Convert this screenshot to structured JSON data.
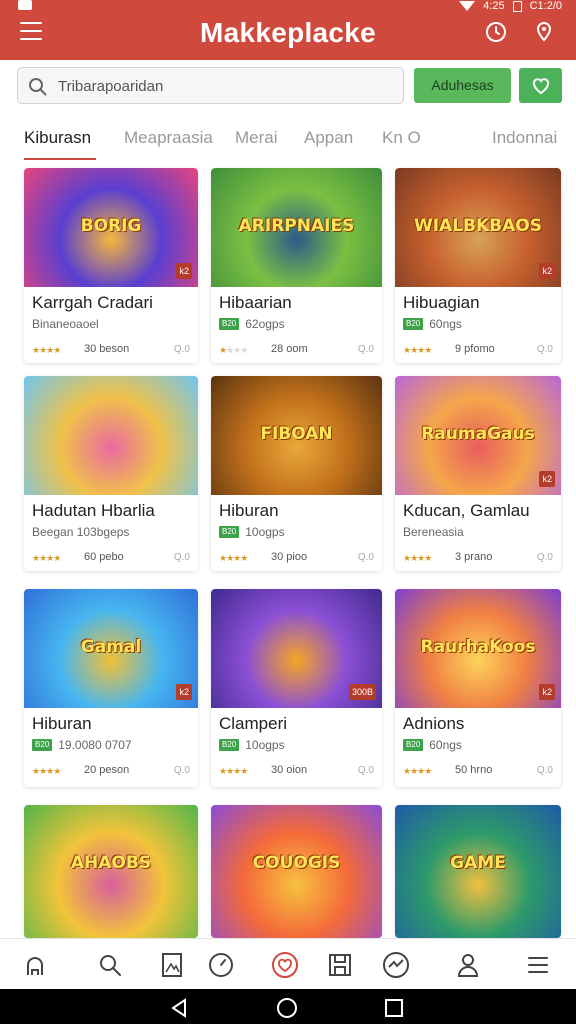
{
  "header": {
    "title": "Makkeplacke",
    "status_time": "4:25",
    "status_extra": "C1:2/0",
    "brand_color": "#cf4a3d"
  },
  "search": {
    "placeholder": "Tribarapoaridan",
    "button_label": "Aduhesas"
  },
  "tabs": [
    {
      "label": "Kiburasn",
      "active": true
    },
    {
      "label": "Meapraasia"
    },
    {
      "label": "Merai"
    },
    {
      "label": "Appan"
    },
    {
      "label": "Kn O"
    },
    {
      "label": "Indonnai"
    }
  ],
  "cards": [
    {
      "thumb_text": "BORIG",
      "badge": "k2",
      "title": "Karrgah Cradari",
      "sub": "Binaneoaoel",
      "sub_badge": "",
      "rating": 4,
      "price": "30 beson",
      "qa": "Q.0",
      "colors": [
        "#e8457c",
        "#5a3fd0",
        "#f6b73c"
      ]
    },
    {
      "thumb_text": "ARIRPNAIES",
      "badge": "",
      "title": "Hibaarian",
      "sub": "62ogps",
      "sub_badge": "B20",
      "rating": 1,
      "price": "28 oom",
      "qa": "Q.0",
      "colors": [
        "#3f8d3b",
        "#7bc043",
        "#2b5a8a"
      ]
    },
    {
      "thumb_text": "WIALBKBAOS",
      "badge": "k2",
      "title": "Hibuagian",
      "sub": "60ngs",
      "sub_badge": "B20",
      "rating": 4,
      "price": "9 pfomo",
      "qa": "Q.0",
      "colors": [
        "#7a3a22",
        "#c7612e",
        "#d8a25a"
      ]
    },
    {
      "thumb_text": "",
      "badge": "",
      "title": "Hadutan Hbarlia",
      "sub": "Beegan 103bgeps",
      "sub_badge": "",
      "rating": 4,
      "price": "60 pebo",
      "qa": "Q.0",
      "colors": [
        "#6fc6ef",
        "#f0c24a",
        "#e96aa0"
      ]
    },
    {
      "thumb_text": "FIBOAN",
      "badge": "",
      "title": "Hiburan",
      "sub": "10ogps",
      "sub_badge": "B20",
      "rating": 4,
      "price": "30 pioo",
      "qa": "Q.0",
      "colors": [
        "#5b3310",
        "#c2711b",
        "#e9a83b"
      ]
    },
    {
      "thumb_text": "RaumaGaus",
      "badge": "k2",
      "title": "Kducan, Gamlau",
      "sub": "Bereneasia",
      "sub_badge": "",
      "rating": 4,
      "price": "3 prano",
      "qa": "Q.0",
      "colors": [
        "#b867d8",
        "#f5a64b",
        "#e85d5d"
      ]
    },
    {
      "thumb_text": "Gamal",
      "badge": "k2",
      "title": "Hiburan",
      "sub": "19.0080 0707",
      "sub_badge": "B20",
      "rating": 4,
      "price": "20 peson",
      "qa": "Q.0",
      "colors": [
        "#2f6fd8",
        "#47b6f0",
        "#f2c035"
      ]
    },
    {
      "thumb_text": "",
      "badge": "300B",
      "title": "Clamperi",
      "sub": "10ogps",
      "sub_badge": "B20",
      "rating": 4,
      "price": "30 oion",
      "qa": "Q.0",
      "colors": [
        "#3f2a8c",
        "#8b4fd6",
        "#f6a623"
      ]
    },
    {
      "thumb_text": "RaurhaKoos",
      "badge": "k2",
      "title": "Adnions",
      "sub": "60ngs",
      "sub_badge": "B20",
      "rating": 4,
      "price": "50 hrno",
      "qa": "Q.0",
      "colors": [
        "#7c3fd1",
        "#f07f44",
        "#fdd35b"
      ]
    },
    {
      "thumb_text": "AHAOBS",
      "badge": "",
      "title": "",
      "sub": "",
      "sub_badge": "",
      "rating": 0,
      "price": "",
      "qa": "",
      "colors": [
        "#4fb54a",
        "#f2c43a",
        "#d85f9c"
      ]
    },
    {
      "thumb_text": "COUOGIS",
      "badge": "",
      "title": "",
      "sub": "",
      "sub_badge": "",
      "rating": 0,
      "price": "",
      "qa": "",
      "colors": [
        "#8a4cd8",
        "#f46a3a",
        "#f7c23f"
      ]
    },
    {
      "thumb_text": "GAME",
      "badge": "",
      "title": "",
      "sub": "",
      "sub_badge": "",
      "rating": 0,
      "price": "",
      "qa": "",
      "colors": [
        "#1f5aa8",
        "#2d9a6a",
        "#f2c040"
      ]
    }
  ],
  "bottom_nav": [
    {
      "icon": "home-icon"
    },
    {
      "icon": "search-icon"
    },
    {
      "icon": "bookmark-icon"
    },
    {
      "icon": "compass-icon"
    },
    {
      "icon": "heart-icon",
      "active": true
    },
    {
      "icon": "save-icon"
    },
    {
      "icon": "chart-icon"
    },
    {
      "icon": "profile-icon"
    },
    {
      "icon": "menu-icon"
    }
  ]
}
